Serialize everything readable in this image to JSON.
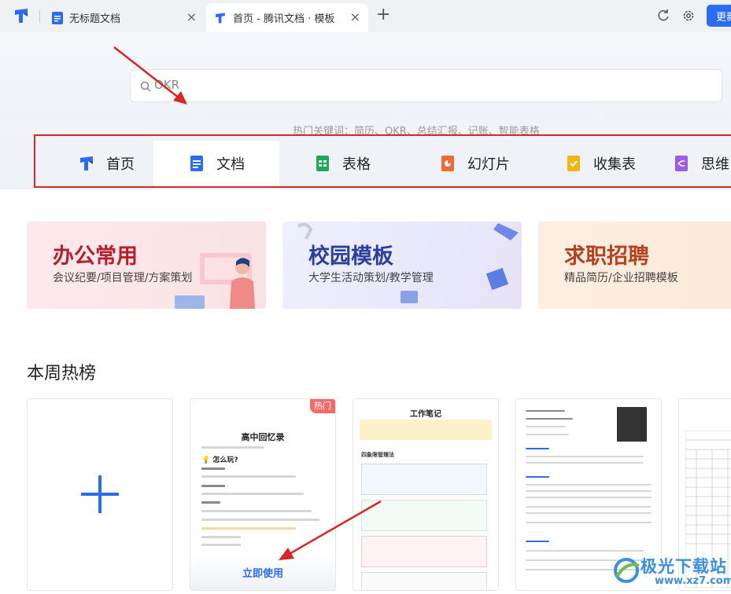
{
  "tabs": [
    {
      "title": "无标题文档"
    },
    {
      "title": "首页 - 腾讯文档 · 模板"
    }
  ],
  "toolbar": {
    "update_label": "更新"
  },
  "search": {
    "value": "OKR",
    "hot_keywords": "热门关键词：简历、OKR、总结汇报、记账、智能表格"
  },
  "categories": [
    {
      "label": "首页",
      "icon": "tencent-docs-icon",
      "color": "#2b6cf0"
    },
    {
      "label": "文档",
      "icon": "doc-icon",
      "color": "#2b6cf0"
    },
    {
      "label": "表格",
      "icon": "sheet-icon",
      "color": "#1fa95b"
    },
    {
      "label": "幻灯片",
      "icon": "slides-icon",
      "color": "#f06a35"
    },
    {
      "label": "收集表",
      "icon": "form-icon",
      "color": "#f3b512"
    },
    {
      "label": "思维",
      "icon": "mindmap-icon",
      "color": "#9b5de5"
    }
  ],
  "banners": [
    {
      "title": "办公常用",
      "subtitle": "会议纪要/项目管理/方案策划"
    },
    {
      "title": "校园模板",
      "subtitle": "大学生活动策划/教学管理"
    },
    {
      "title": "求职招聘",
      "subtitle": "精品简历/企业招聘模板"
    }
  ],
  "section": {
    "title": "本周热榜"
  },
  "cards": {
    "hot_badge": "热门",
    "card2_title": "高中回忆录",
    "card2_q": "怎么玩?",
    "card3_title": "工作笔记",
    "card3_sub": "四象限管理法",
    "use_label": "立即使用"
  },
  "watermark": {
    "text": "极光下载站",
    "url": "www.xz7.com"
  },
  "colors": {
    "accent": "#2b6cf0",
    "annotation_red": "#d62828"
  }
}
